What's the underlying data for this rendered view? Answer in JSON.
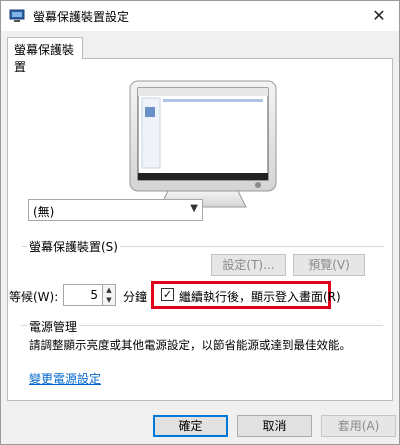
{
  "window": {
    "title": "螢幕保護裝置設定",
    "close_glyph": "✕"
  },
  "tab": {
    "label": "螢幕保護裝置"
  },
  "screensaver": {
    "group_label": "螢幕保護裝置(S)",
    "selected": "(無)",
    "settings_button": "設定(T)...",
    "preview_button": "預覽(V)",
    "wait_label": "等候(W):",
    "wait_value": "5",
    "minutes_label": "分鐘",
    "resume_checkbox_label": "繼續執行後，顯示登入畫面(R)",
    "resume_checked": true
  },
  "power": {
    "group_label": "電源管理",
    "description": "請調整顯示亮度或其他電源設定，以節省能源或達到最佳效能。",
    "link": "變更電源設定"
  },
  "footer": {
    "ok": "確定",
    "cancel": "取消",
    "apply": "套用(A)"
  },
  "colors": {
    "highlight": "#e0001b",
    "link": "#0066cc",
    "accent": "#0078d7"
  }
}
